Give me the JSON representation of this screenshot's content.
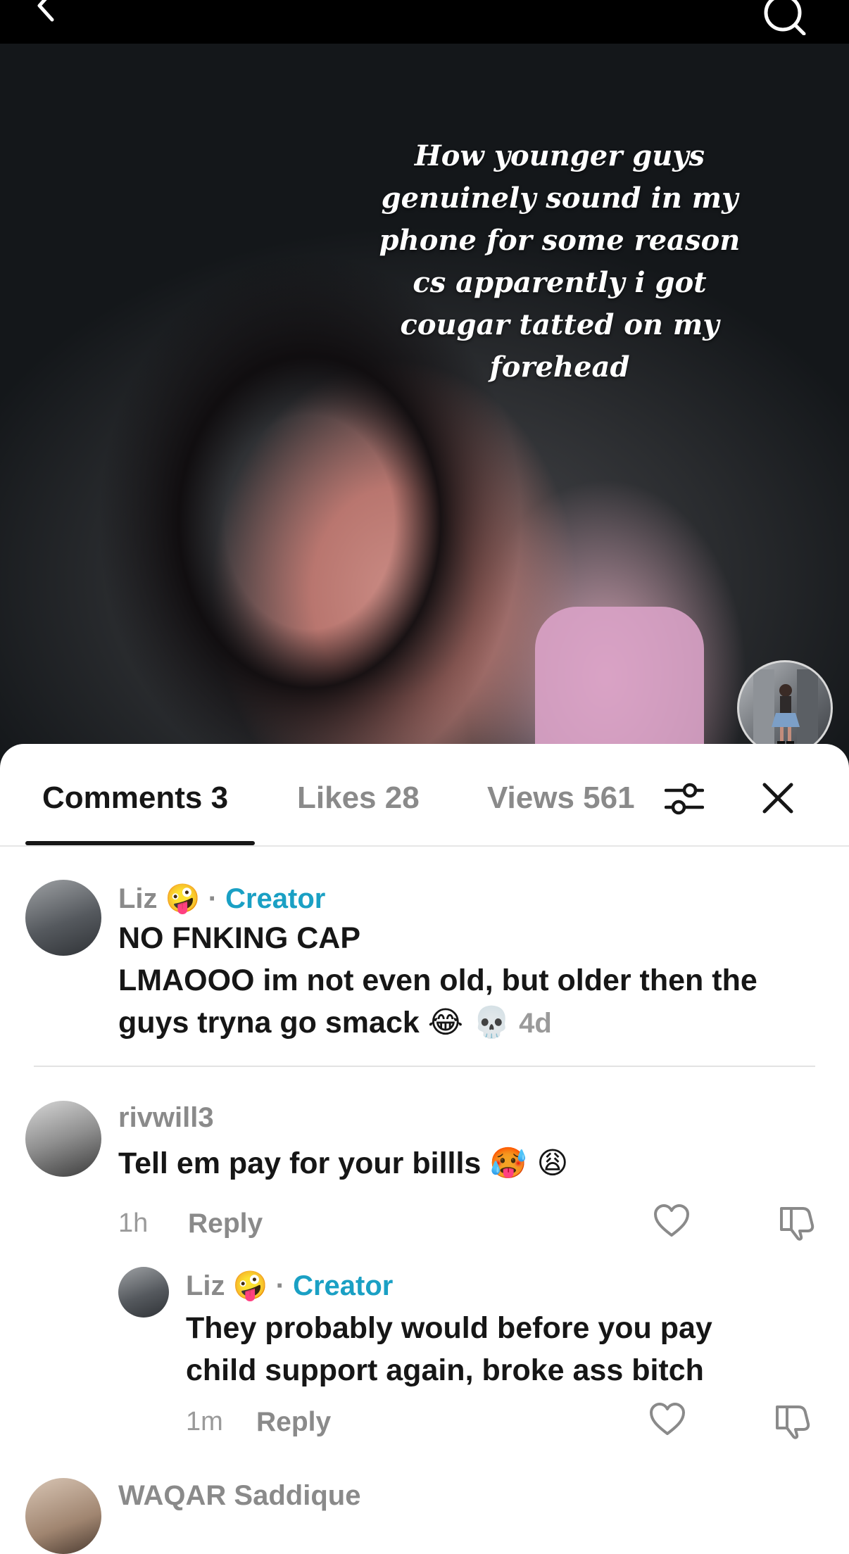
{
  "video": {
    "caption": "How younger guys genuinely sound in my phone for some reason cs apparently i got cougar tatted on my forehead"
  },
  "tabs": {
    "comments": "Comments 3",
    "likes": "Likes 28",
    "views": "Views 561"
  },
  "comments": [
    {
      "author": "Liz",
      "author_emoji": "🤪",
      "separator": "·",
      "badge": "Creator",
      "text_line1": "NO FNKING CAP",
      "text_line2": "LMAOOO im not even old, but older then the",
      "text_line3": "guys tryna go smack",
      "text_emojis": "😂 💀",
      "time": "4d"
    },
    {
      "author": "rivwill3",
      "text": "Tell em pay for your billls",
      "text_emojis": "🥵 😩",
      "time": "1h",
      "reply_label": "Reply"
    },
    {
      "author": "Liz",
      "author_emoji": "🤪",
      "separator": "·",
      "badge": "Creator",
      "text_line1": "They probably would before you pay",
      "text_line2": "child support again, broke ass bitch",
      "time": "1m",
      "reply_label": "Reply"
    },
    {
      "author": "WAQAR Saddique"
    }
  ],
  "icons": {
    "back": "chevron-left-icon",
    "search": "search-icon",
    "filter": "sliders-icon",
    "close": "close-icon",
    "like": "heart-icon",
    "dislike": "thumbs-down-icon"
  },
  "colors": {
    "creator_badge": "#1aa0c4",
    "text_primary": "#161616",
    "text_secondary": "#8a8a8a"
  }
}
